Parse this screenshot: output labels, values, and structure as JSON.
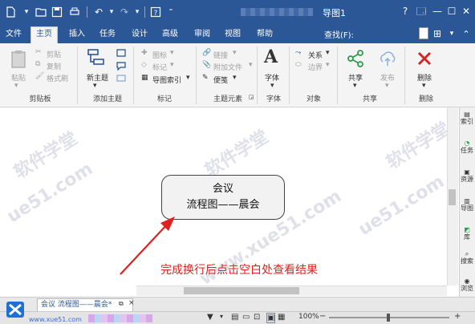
{
  "window": {
    "title": "导图1",
    "controls": [
      "?",
      "🗔",
      "—",
      "☐",
      "✕"
    ]
  },
  "quick_access": {
    "icons": [
      "new-icon",
      "open-icon",
      "save-icon",
      "print-icon",
      "undo-icon",
      "redo-icon",
      "help-icon"
    ]
  },
  "menu_tabs": [
    "文件",
    "主页",
    "插入",
    "任务",
    "设计",
    "高级",
    "审阅",
    "视图",
    "帮助"
  ],
  "active_tab": "主页",
  "search": {
    "label": "查找(F):",
    "value": ""
  },
  "ribbon": {
    "groups": [
      {
        "label": "剪贴板",
        "items": [
          "粘贴",
          "剪贴",
          "复制",
          "格式刷"
        ]
      },
      {
        "label": "添加主题",
        "items": [
          "新主题"
        ]
      },
      {
        "label": "标记",
        "items": [
          "图标",
          "标记",
          "导图索引"
        ]
      },
      {
        "label": "主题元素",
        "items": [
          "链接",
          "附加文件",
          "便笺"
        ]
      },
      {
        "label": "字体",
        "items": [
          "字体"
        ]
      },
      {
        "label": "对象",
        "items": [
          "关系",
          "边界"
        ]
      },
      {
        "label": "共享",
        "items": [
          "共享",
          "发布"
        ]
      },
      {
        "label": "删除",
        "items": [
          "删除"
        ]
      }
    ]
  },
  "topic": {
    "line1": "会议",
    "line2": "流程图——晨会"
  },
  "annotation": "完成换行后点击空白处查看结果",
  "watermark": [
    "软件学堂",
    "ue51.com",
    "www.xue51.com"
  ],
  "side_panel": [
    "索引",
    "任务",
    "资源",
    "导图",
    "库",
    "搜索",
    "浏览"
  ],
  "doc_tab": {
    "label": "会议 流程图——晨会*"
  },
  "status": {
    "zoom": "100%"
  },
  "site": {
    "logo_text": "www.xue51.com"
  },
  "colors": {
    "brand": "#2b5797",
    "annotation": "#e02020",
    "arrow": "#e02020"
  }
}
